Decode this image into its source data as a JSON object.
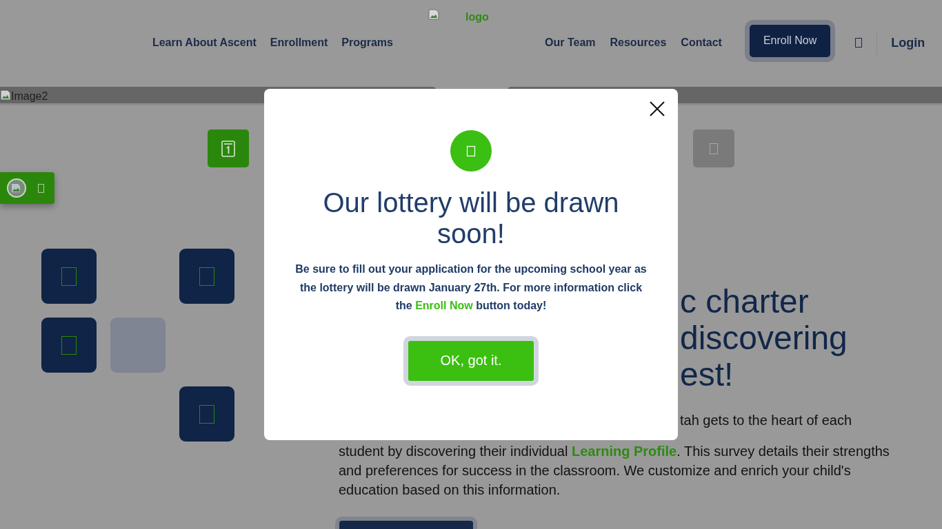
{
  "header": {
    "nav_left": [
      "Learn About Ascent",
      "Enrollment",
      "Programs"
    ],
    "logo": {
      "alt_text": "logo"
    },
    "nav_right": [
      "Our Team",
      "Resources",
      "Contact"
    ],
    "enroll_button": "Enroll Now",
    "login": "Login"
  },
  "banner": {
    "alt_text": "Image2"
  },
  "tabs": [
    {
      "selected": true
    },
    {
      "selected": false
    }
  ],
  "tiles": [
    {
      "kind": "icon"
    },
    {
      "kind": "empty"
    },
    {
      "kind": "icon"
    },
    {
      "kind": "icon"
    },
    {
      "kind": "plain"
    },
    {
      "kind": "empty"
    },
    {
      "kind": "empty"
    },
    {
      "kind": "empty"
    },
    {
      "kind": "icon"
    }
  ],
  "hero": {
    "heading_lines": [
      "c charter",
      "discovering",
      "est!"
    ],
    "paragraph_fragment": "tah gets to the heart of each",
    "paragraph": {
      "before": "student by discovering their individual ",
      "link": "Learning Profile",
      "after": ". This survey details their strengths and preferences for success in the classroom. We customize and enrich your child's education based on this information."
    }
  },
  "modal": {
    "title": "Our lottery will be drawn soon!",
    "message": {
      "before": "Be sure to fill out your application for the upcoming school year as the lottery will be drawn January 27th. For more information click the ",
      "link": "Enroll Now",
      "after": " button today!"
    },
    "button": "OK, got it."
  }
}
